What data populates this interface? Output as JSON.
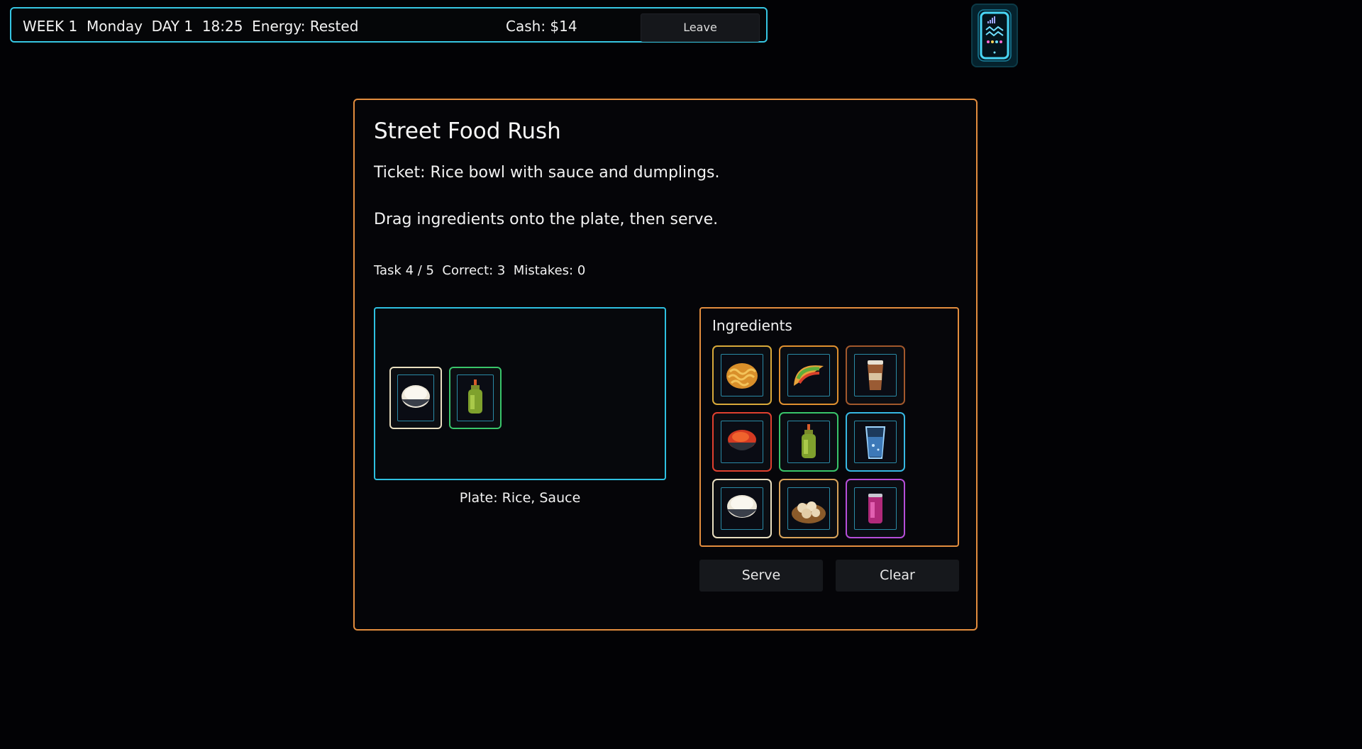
{
  "hud": {
    "status": "WEEK 1  Monday  DAY 1  18:25  Energy: Rested",
    "cash": "Cash: $14",
    "leave_label": "Leave"
  },
  "phone": {
    "icon": "phone-icon"
  },
  "game": {
    "title": "Street Food Rush",
    "ticket": "Ticket: Rice bowl with sauce and dumplings.",
    "instructions": "Drag ingredients onto the plate, then serve.",
    "stats": "Task 4 / 5  Correct: 3  Mistakes: 0",
    "plate_summary": "Plate: Rice, Sauce",
    "plate_items": [
      {
        "icon": "rice-bowl-icon",
        "border": "#e9dfc0"
      },
      {
        "icon": "sauce-bottle-icon",
        "border": "#39c56a"
      }
    ],
    "ingredients_label": "Ingredients",
    "ingredients": [
      {
        "icon": "noodles-icon",
        "border": "#d8a93a"
      },
      {
        "icon": "taco-icon",
        "border": "#e0902f"
      },
      {
        "icon": "coffee-cup-icon",
        "border": "#a2582c"
      },
      {
        "icon": "chili-powder-bowl-icon",
        "border": "#e0402f"
      },
      {
        "icon": "sauce-bottle-icon",
        "border": "#39c56a"
      },
      {
        "icon": "water-glass-icon",
        "border": "#37b8e3"
      },
      {
        "icon": "rice-bowl-icon",
        "border": "#e9dfc0"
      },
      {
        "icon": "dumplings-basket-icon",
        "border": "#d9a35a"
      },
      {
        "icon": "soda-can-icon",
        "border": "#b64ed9"
      }
    ],
    "serve_label": "Serve",
    "clear_label": "Clear"
  },
  "colors": {
    "accent_cyan": "#36c6e3",
    "accent_orange": "#e38d3e",
    "background": "#020205"
  }
}
